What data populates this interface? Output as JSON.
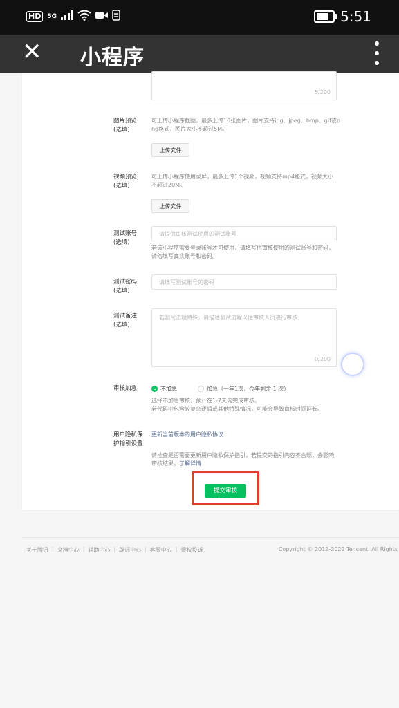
{
  "status_bar": {
    "hd": "HD",
    "network": "5G",
    "time": "5:51"
  },
  "app_bar": {
    "title": "小程序",
    "close_icon": "close-icon",
    "more_icon": "more-vertical-icon"
  },
  "form": {
    "description_counter": "5/200",
    "image_preview": {
      "label": "图片预览\n(选填)",
      "hint": "可上传小程序截图，最多上传10张图片，图片支持jpg、jpeg、bmp、gif或p\nng格式，图片大小不超过5M。",
      "button": "上传文件"
    },
    "video_preview": {
      "label": "视频预览\n(选填)",
      "hint": "可上传小程序使用录屏，最多上传1个视频，视频支持mp4格式，视频大小\n不超过20M。",
      "button": "上传文件"
    },
    "test_account": {
      "label": "测试账号\n(选填)",
      "placeholder": "请提供审核测试使用的测试账号",
      "hint": "若该小程序需要登录账号才可使用，请填写供审核使用的测试账号和密码，\n请勿填写真实账号和密码。"
    },
    "test_password": {
      "label": "测试密码\n(选填)",
      "placeholder": "请填写测试账号的密码"
    },
    "test_notes": {
      "label": "测试备注\n(选填)",
      "placeholder": "若测试流程特殊，请描述测试流程以便审核人员进行审核",
      "counter": "0/200"
    },
    "review_speed": {
      "label": "审核加急",
      "option_normal": "不加急",
      "option_urgent": "加急（一年1次，今年剩余 1 次）",
      "hint": "选择不加急审核，预计在1-7天内完成审核。\n若代码中包含较复杂逻辑或其他特殊情况，可能会导致审核时间延长。"
    },
    "privacy": {
      "label": "用户隐私保\n护指引设置",
      "link": "更新当前版本的用户隐私协议",
      "hint_prefix": "请检查是否需要更新用户隐私保护指引，若提交的指引内容不合规，会影响\n审核结果。",
      "hint_link": "了解详情"
    },
    "submit": "提交审核"
  },
  "footer": {
    "links": [
      "关于腾讯",
      "文档中心",
      "辅助中心",
      "辟谣中心",
      "客服中心",
      "侵权投诉"
    ],
    "copyright": "Copyright © 2012-2022 Tencent. All Rights"
  },
  "colors": {
    "primary": "#07c160",
    "highlight": "#e03e2d",
    "link": "#576b95"
  }
}
